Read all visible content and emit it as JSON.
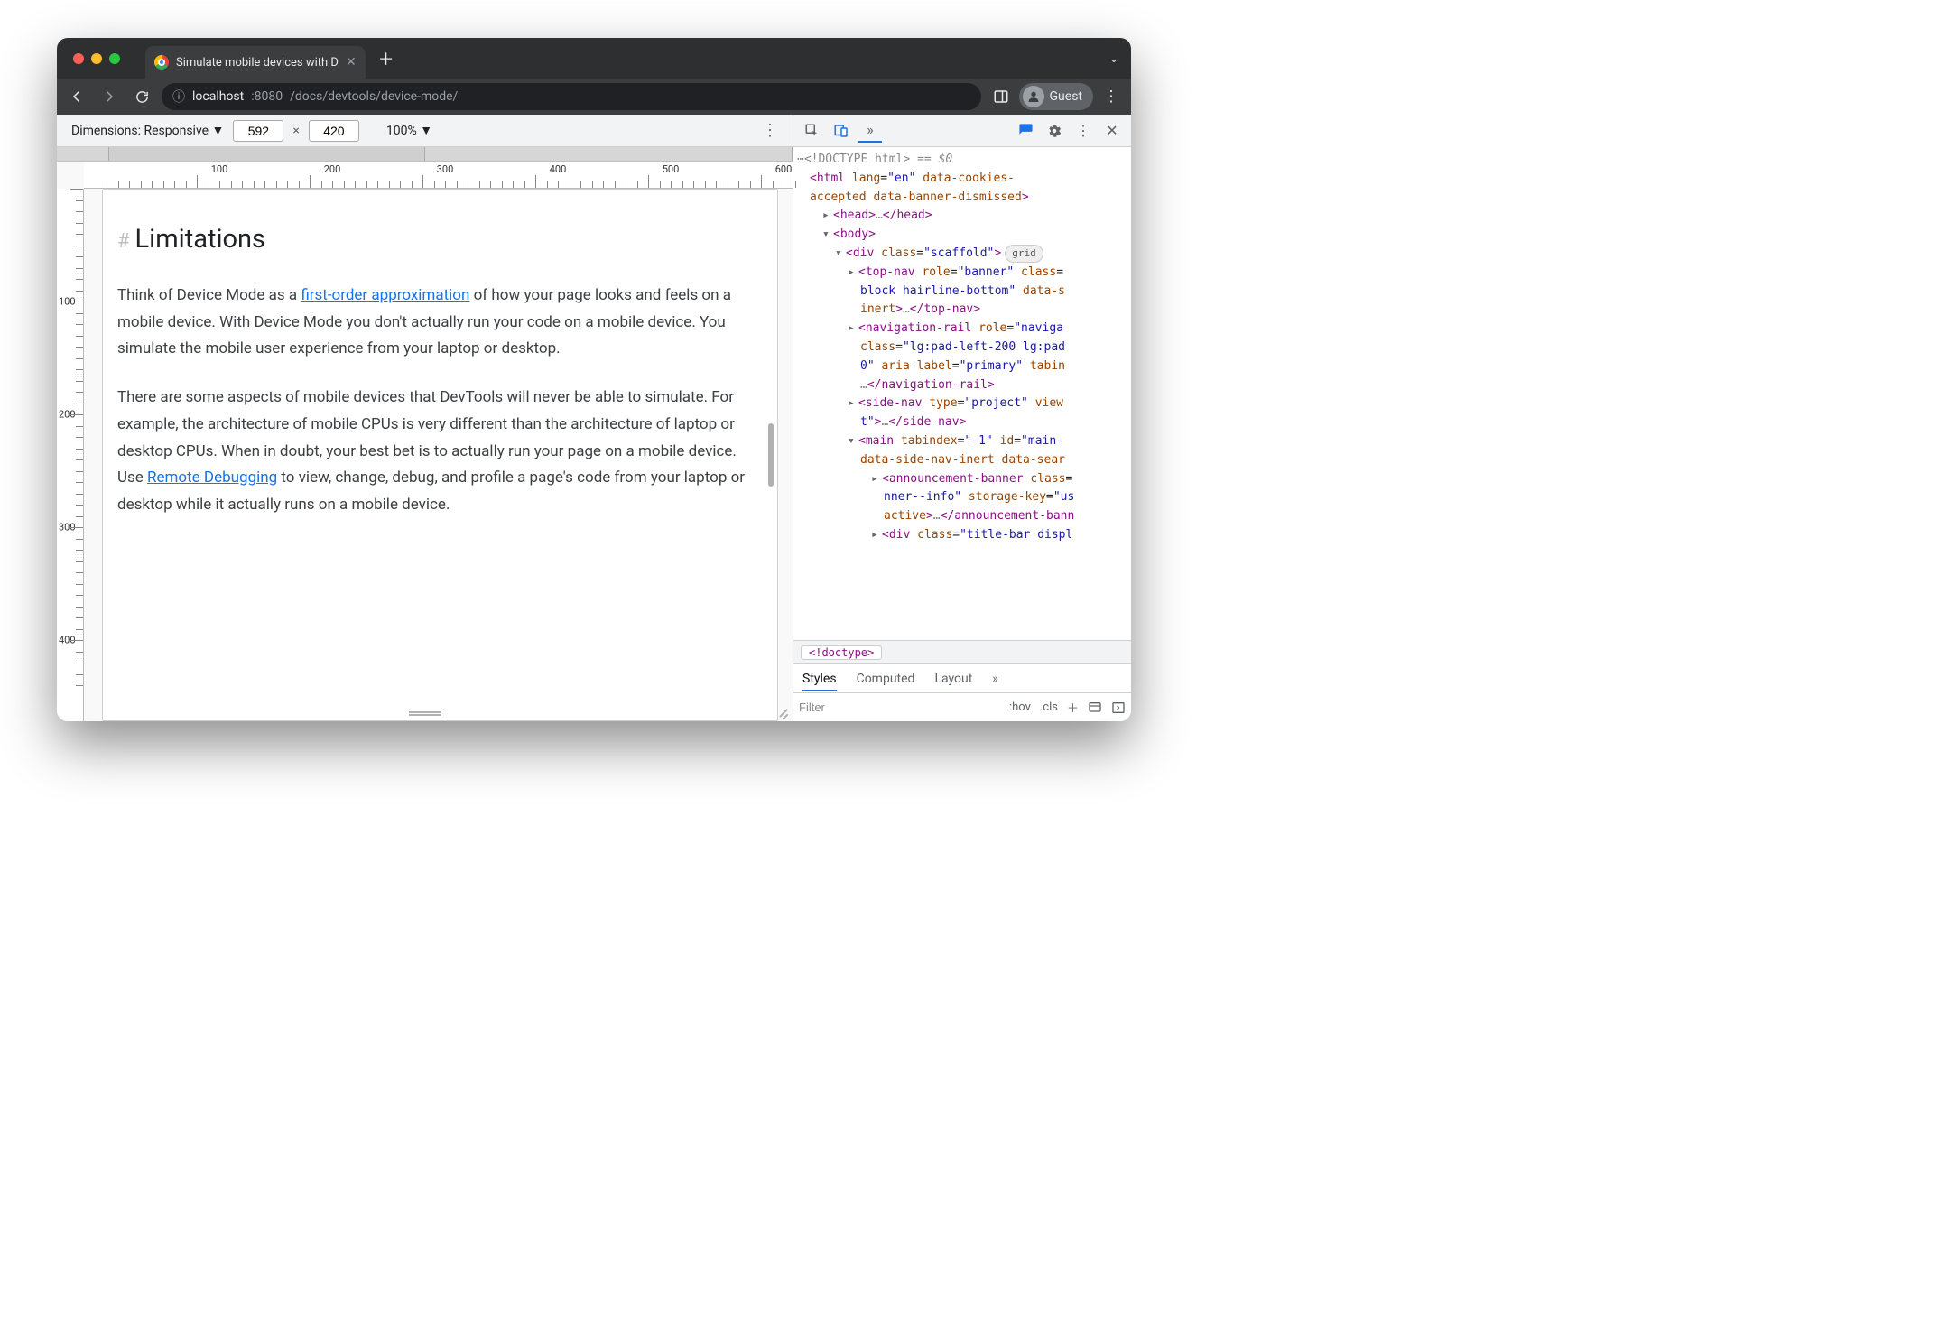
{
  "browser": {
    "tab_title": "Simulate mobile devices with D",
    "guest_label": "Guest",
    "url_host": "localhost",
    "url_port": ":8080",
    "url_path": "/docs/devtools/device-mode/"
  },
  "device_toolbar": {
    "label": "Dimensions: Responsive",
    "width": "592",
    "height": "420",
    "zoom": "100%"
  },
  "ruler_h": [
    "100",
    "200",
    "300",
    "400",
    "500",
    "600"
  ],
  "ruler_v": [
    "100",
    "200",
    "300",
    "400"
  ],
  "page": {
    "heading_hash": "#",
    "heading": "Limitations",
    "p1_pre": "Think of Device Mode as a ",
    "p1_link": "first-order approximation",
    "p1_post": " of how your page looks and feels on a mobile device. With Device Mode you don't actually run your code on a mobile device. You simulate the mobile user experience from your laptop or desktop.",
    "p2_pre": "There are some aspects of mobile devices that DevTools will never be able to simulate. For example, the architecture of mobile CPUs is very different than the architecture of laptop or desktop CPUs. When in doubt, your best bet is to actually run your page on a mobile device. Use ",
    "p2_link": "Remote Debugging",
    "p2_post": " to view, change, debug, and profile a page's code from your laptop or desktop while it actually runs on a mobile device."
  },
  "devtools": {
    "eq_eq": "== ",
    "dollar0": "$0",
    "doctype": "<!DOCTYPE html>",
    "pill_grid": "grid",
    "crumb": "<!doctype>",
    "styles_tabs": {
      "styles": "Styles",
      "computed": "Computed",
      "layout": "Layout"
    },
    "filter_placeholder": "Filter",
    "hov": ":hov",
    "cls": ".cls",
    "lines": {
      "html_open": "<html lang=\"en\" data-cookies-accepted data-banner-dismissed>",
      "head": "<head>…</head>",
      "body_open": "<body>",
      "scaffold": "<div class=\"scaffold\">",
      "topnav1": "<top-nav role=\"banner\" class=\"",
      "topnav2": "block hairline-bottom\" data-s",
      "topnav3": "inert>…</top-nav>",
      "navrail1": "<navigation-rail role=\"naviga",
      "navrail2": "class=\"lg:pad-left-200 lg:pad",
      "navrail3": "0\" aria-label=\"primary\" tabin",
      "navrail4": "…</navigation-rail>",
      "sidenav1": "<side-nav type=\"project\" view",
      "sidenav2": "t\">…</side-nav>",
      "main1": "<main tabindex=\"-1\" id=\"main-",
      "main2": "data-side-nav-inert data-sear",
      "ann1": "<announcement-banner class=\"",
      "ann2": "nner--info\" storage-key=\"us",
      "ann3": "active>…</announcement-bann",
      "title1": "<div class=\"title-bar displ"
    }
  }
}
